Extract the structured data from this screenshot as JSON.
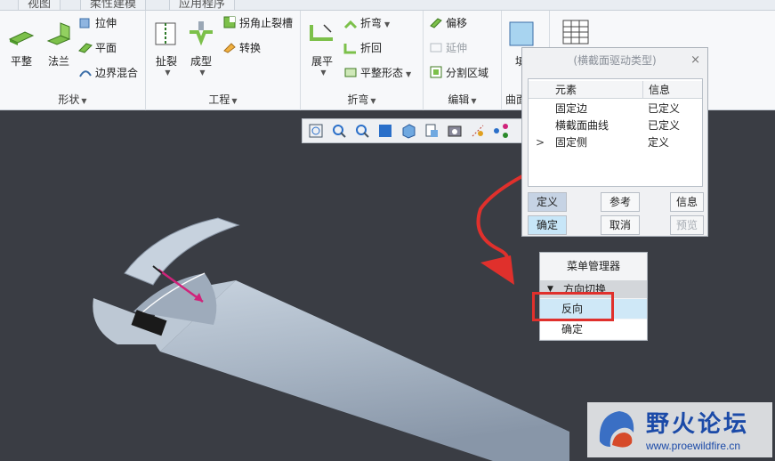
{
  "tabs": [
    "视图",
    "柔性建模",
    "应用程序"
  ],
  "groups": {
    "shape": {
      "label": "形状",
      "big": [
        "平整",
        "法兰"
      ],
      "small": [
        "拉伸",
        "平面",
        "边界混合"
      ]
    },
    "engineering": {
      "label": "工程",
      "big": [
        "扯裂",
        "成型"
      ],
      "small": [
        "拐角止裂槽",
        "转换"
      ]
    },
    "bend": {
      "label": "折弯",
      "big": [
        "展平"
      ],
      "small": [
        "折弯",
        "折回",
        "平整形态"
      ]
    },
    "edit": {
      "label": "编辑",
      "small": [
        "偏移",
        "延伸",
        "分割区域"
      ]
    },
    "surface": {
      "label": "曲面",
      "big": [
        "填"
      ]
    }
  },
  "dialog": {
    "title": "(横截面驱动类型)",
    "close": "×",
    "columns": [
      "元素",
      "信息"
    ],
    "rows": [
      {
        "marker": "",
        "element": "固定边",
        "info": "已定义"
      },
      {
        "marker": "",
        "element": "横截面曲线",
        "info": "已定义"
      },
      {
        "marker": ">",
        "element": "固定侧",
        "info": "定义"
      }
    ],
    "buttons": {
      "define": "定义",
      "reference": "参考",
      "info": "信息",
      "ok": "确定",
      "cancel": "取消",
      "preview": "预览"
    }
  },
  "menu_manager": {
    "title": "菜单管理器",
    "submenu": "方向切换",
    "items": [
      "反向",
      "确定"
    ]
  },
  "watermark": {
    "title": "野火论坛",
    "url": "www.proewildfire.cn"
  },
  "colors": {
    "annotation_red": "#e0302c",
    "viewport_bg": "#3a3d44",
    "part_color": "#b7c3d0"
  }
}
